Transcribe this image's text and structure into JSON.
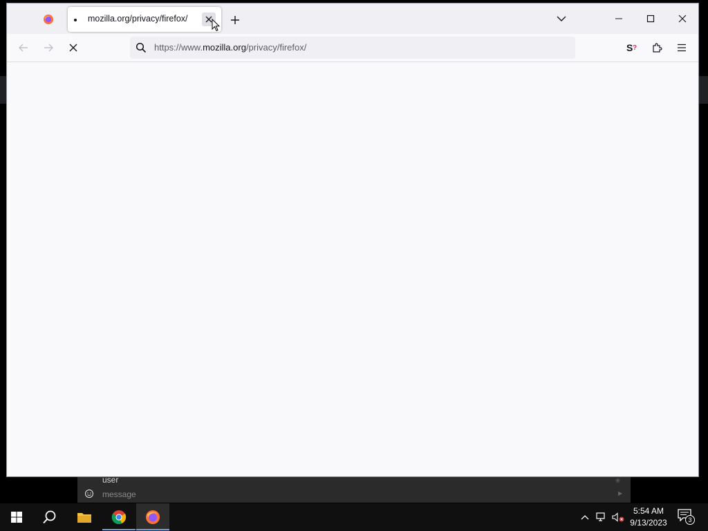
{
  "browser": {
    "tabs": [
      {
        "label": "",
        "pinned": true,
        "icon": "firefox-icon"
      },
      {
        "label": "mozilla.org/privacy/firefox/",
        "active": true,
        "loading": true
      }
    ],
    "url": {
      "prefix": "https://www.",
      "host": "mozilla.org",
      "path": "/privacy/firefox/"
    },
    "icons": [
      "back-icon",
      "forward-icon",
      "stop-icon",
      "search-icon",
      "extension-s-icon",
      "extensions-puzzle-icon",
      "app-menu-icon",
      "list-all-tabs-icon",
      "new-tab-icon",
      "minimize-icon",
      "maximize-icon",
      "close-icon"
    ]
  },
  "chat": {
    "user_label": "user",
    "message_placeholder": "message"
  },
  "taskbar": {
    "apps": [
      "start-icon",
      "search-icon",
      "file-explorer-icon",
      "chrome-icon",
      "firefox-icon"
    ],
    "time": "5:54 AM",
    "date": "9/13/2023",
    "notification_count": "3"
  },
  "colors": {
    "content_bg": "#f9f9fb",
    "tabbar_bg": "#f0f0f4",
    "taskbar_bg": "#101010",
    "accent": "#7a9ccc"
  }
}
